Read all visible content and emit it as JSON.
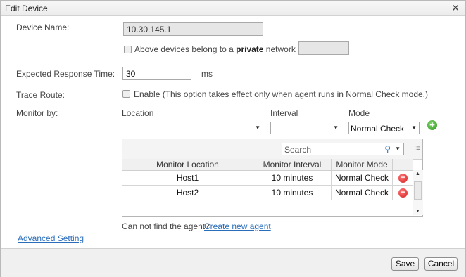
{
  "dialog": {
    "title": "Edit Device",
    "close_glyph": "✕"
  },
  "device_name": {
    "label": "Device Name:",
    "value": "10.30.145.1"
  },
  "private_network": {
    "prefix": "Above devices belong to a ",
    "bold": "private",
    "suffix": " network of",
    "value": ""
  },
  "response_time": {
    "label": "Expected Response Time:",
    "value": "30",
    "unit": "ms"
  },
  "trace_route": {
    "label": "Trace Route:",
    "text": "Enable (This option takes effect only when agent runs in Normal Check mode.)"
  },
  "monitor": {
    "label": "Monitor by:",
    "location_label": "Location",
    "interval_label": "Interval",
    "mode_label": "Mode",
    "location_value": "",
    "interval_value": "",
    "mode_value": "Normal Check",
    "search_placeholder": "Search",
    "columns": [
      "Monitor Location",
      "Monitor Interval",
      "Monitor Mode"
    ],
    "rows": [
      {
        "location": "Host1",
        "interval": "10 minutes",
        "mode": "Normal Check"
      },
      {
        "location": "Host2",
        "interval": "10 minutes",
        "mode": "Normal Check"
      }
    ],
    "agent_prompt": "Can not find the agent?",
    "create_agent_link": "Create new agent"
  },
  "advanced_link": "Advanced Setting",
  "buttons": {
    "save": "Save",
    "cancel": "Cancel"
  },
  "icons": {
    "add": "add-icon",
    "remove": "remove-icon",
    "search": "search-icon"
  },
  "colors": {
    "link": "#2a6ebb",
    "add": "#2e9a1f",
    "remove": "#d41c1c"
  }
}
